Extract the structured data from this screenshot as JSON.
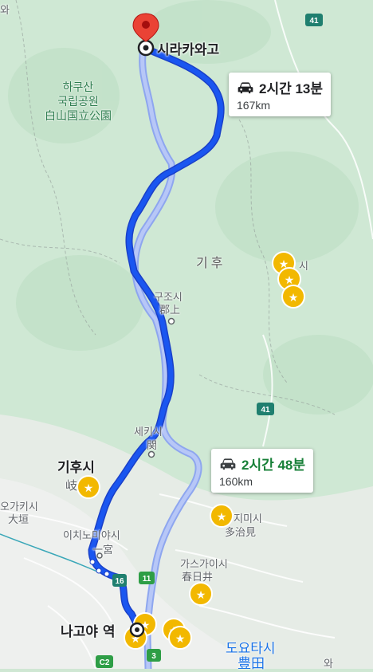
{
  "labels": {
    "destination": "시라카와고",
    "park_ko_1": "하쿠산",
    "park_ko_2": "국립공원",
    "park_ja": "白山国立公園",
    "region": "기후",
    "gujo_ko": "구조시",
    "gujo_ja": "郡上",
    "seki_ko": "세키시",
    "seki_ja": "関",
    "gifu_ko": "기후시",
    "gifu_ja": "岐",
    "ogaki_ko": "오가키시",
    "ogaki_ja": "大垣",
    "ichinomiya_ko": "이치노미야시",
    "ichinomiya_ja": "一宮",
    "tajimi_ko": "지미시",
    "tajimi_ja": "多治見",
    "kasugai_ko": "가스가이시",
    "kasugai_ja": "春日井",
    "nagoya": "나고야 역",
    "toyota_ko": "도요타시",
    "toyota_ja": "豊田",
    "ena_partial": "시",
    "bottom_partial": "와",
    "corner_partial": "와"
  },
  "route_shields": [
    "41",
    "41",
    "16",
    "11",
    "3",
    "C2"
  ],
  "routes": [
    {
      "time": "2시간 13분",
      "distance": "167km",
      "selected": true,
      "time_color": "#202124"
    },
    {
      "time": "2시간 48분",
      "distance": "160km",
      "selected": false,
      "time_color": "#188038"
    }
  ],
  "colors": {
    "selected_route": "#1a56f0",
    "alt_route": "#a6b8f5",
    "pin_red": "#ea4335",
    "star_fill": "#f2b800"
  }
}
